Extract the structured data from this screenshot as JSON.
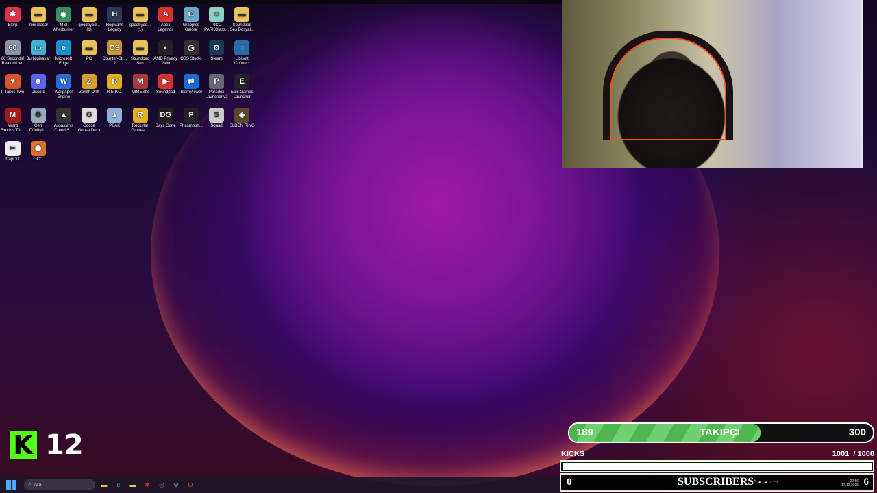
{
  "desktop": {
    "icons": [
      {
        "label": "Blerp",
        "name": "blerp-icon",
        "glyph": "✱",
        "bg": "#d9334a"
      },
      {
        "label": "Yeni klasör",
        "name": "folder-icon",
        "glyph": "▬",
        "bg": "#e8c25a"
      },
      {
        "label": "MSI Afterburner",
        "name": "msi-afterburner-icon",
        "glyph": "◉",
        "bg": "#3a8f5a"
      },
      {
        "label": "goodbyed... (1)",
        "name": "folder-icon",
        "glyph": "▬",
        "bg": "#e8c25a"
      },
      {
        "label": "Hogwarts Legacy",
        "name": "hogwarts-legacy-icon",
        "glyph": "H",
        "bg": "#2a3a55"
      },
      {
        "label": "goodbyed... (1)",
        "name": "folder-icon",
        "glyph": "▬",
        "bg": "#e8c25a"
      },
      {
        "label": "Apex Legends",
        "name": "apex-legends-icon",
        "glyph": "A",
        "bg": "#d8322e"
      },
      {
        "label": "Grapples Galore",
        "name": "grapples-galore-icon",
        "glyph": "G",
        "bg": "#6aa7c4"
      },
      {
        "label": "PICO PARKClass...",
        "name": "pico-park-icon",
        "glyph": "☺",
        "bg": "#8fd0c8"
      },
      {
        "label": "Soundpad Ses Dosyal...",
        "name": "folder-icon",
        "glyph": "▬",
        "bg": "#e8c25a"
      },
      {
        "label": "60 Seconds! Reatomized",
        "name": "60-seconds-icon",
        "glyph": "60",
        "bg": "#8a96a8"
      },
      {
        "label": "Bu bilgisayar",
        "name": "this-pc-icon",
        "glyph": "▭",
        "bg": "#3fb0d8"
      },
      {
        "label": "Microsoft Edge",
        "name": "edge-icon",
        "glyph": "e",
        "bg": "#1c8fd0"
      },
      {
        "label": "PC",
        "name": "folder-icon",
        "glyph": "▬",
        "bg": "#e8c25a"
      },
      {
        "label": "Counter-Str... 2",
        "name": "counter-strike-icon",
        "glyph": "CS",
        "bg": "#c79a3a"
      },
      {
        "label": "Soundpad Ses",
        "name": "folder-icon",
        "glyph": "▬",
        "bg": "#e8c25a"
      },
      {
        "label": "AMD Privacy View",
        "name": "amd-privacy-view-icon",
        "glyph": "◐",
        "bg": "#222"
      },
      {
        "label": "OBS Studio",
        "name": "obs-studio-icon",
        "glyph": "◎",
        "bg": "#333"
      },
      {
        "label": "Steam",
        "name": "steam-icon",
        "glyph": "⚙",
        "bg": "#1b3a5a"
      },
      {
        "label": "Ubisoft Connect",
        "name": "ubisoft-connect-icon",
        "glyph": "◌",
        "bg": "#2a6aa8"
      },
      {
        "label": "It Takes Two",
        "name": "it-takes-two-icon",
        "glyph": "♥",
        "bg": "#d8562e"
      },
      {
        "label": "Discord",
        "name": "discord-icon",
        "glyph": "☻",
        "bg": "#5865f2"
      },
      {
        "label": "Wallpaper Engine",
        "name": "wallpaper-engine-icon",
        "glyph": "W",
        "bg": "#2a6ad8"
      },
      {
        "label": "Zenith Drift",
        "name": "zenith-drift-icon",
        "glyph": "Z",
        "bg": "#d8a02e"
      },
      {
        "label": "R.E.P.O.",
        "name": "repo-icon",
        "glyph": "R",
        "bg": "#e0b020"
      },
      {
        "label": "MIMESIS",
        "name": "mimesis-icon",
        "glyph": "M",
        "bg": "#aa3a3a"
      },
      {
        "label": "Soundpad",
        "name": "soundpad-icon",
        "glyph": "▶",
        "bg": "#d83030"
      },
      {
        "label": "TeamViewer",
        "name": "teamviewer-icon",
        "glyph": "⇄",
        "bg": "#1a6ad8"
      },
      {
        "label": "Paradox Launcher v2",
        "name": "paradox-launcher-icon",
        "glyph": "P",
        "bg": "#667"
      },
      {
        "label": "Epic Games Launcher",
        "name": "epic-games-icon",
        "glyph": "E",
        "bg": "#222"
      },
      {
        "label": "Metro Exodus Tür...",
        "name": "metro-exodus-icon",
        "glyph": "M",
        "bg": "#a81a1a"
      },
      {
        "label": "Geri Dönüşü...",
        "name": "recycle-bin-icon",
        "glyph": "♻",
        "bg": "#9ab"
      },
      {
        "label": "Assassin's Creed S...",
        "name": "assassins-creed-icon",
        "glyph": "▲",
        "bg": "#333"
      },
      {
        "label": "Goose Goose Duck",
        "name": "goose-goose-duck-icon",
        "glyph": "G",
        "bg": "#ddd"
      },
      {
        "label": "PEAK",
        "name": "peak-icon",
        "glyph": "▲",
        "bg": "#8fb0d8"
      },
      {
        "label": "Rockstar Games ...",
        "name": "rockstar-games-icon",
        "glyph": "R",
        "bg": "#e0b020"
      },
      {
        "label": "Days Gone",
        "name": "days-gone-icon",
        "glyph": "DG",
        "bg": "#222"
      },
      {
        "label": "Phasmoph...",
        "name": "phasmophobia-icon",
        "glyph": "P",
        "bg": "#222"
      },
      {
        "label": "Squad",
        "name": "squad-icon",
        "glyph": "S",
        "bg": "#ccc"
      },
      {
        "label": "ELDEN RING",
        "name": "elden-ring-icon",
        "glyph": "◈",
        "bg": "#5a4a2a"
      },
      {
        "label": "CapCut",
        "name": "capcut-icon",
        "glyph": "✂",
        "bg": "#eee"
      },
      {
        "label": "GCC",
        "name": "gcc-icon",
        "glyph": "⬢",
        "bg": "#e0702e"
      }
    ]
  },
  "overlay": {
    "kick_logo": "K",
    "kick_viewers": "12",
    "followers": {
      "current": "189",
      "label": "TAKIPÇI",
      "goal": "300",
      "progress": 0.63
    },
    "kicks": {
      "label": "KICKS",
      "count": "1001",
      "goal": "/ 1000",
      "progress": 1.0
    },
    "subs": {
      "current": "0",
      "label": "SUBSCRIBERS",
      "goal": "6"
    }
  },
  "taskbar": {
    "search_placeholder": "Ara",
    "apps": [
      {
        "name": "file-explorer-icon",
        "glyph": "▬",
        "color": "#e8c25a"
      },
      {
        "name": "edge-taskbar-icon",
        "glyph": "e",
        "color": "#1c8fd0"
      },
      {
        "name": "folder-taskbar-icon",
        "glyph": "▬",
        "color": "#e8c25a"
      },
      {
        "name": "blerp-taskbar-icon",
        "glyph": "✱",
        "color": "#d9334a"
      },
      {
        "name": "obs-taskbar-icon",
        "glyph": "◎",
        "color": "#888"
      },
      {
        "name": "steam-taskbar-icon",
        "glyph": "⚙",
        "color": "#8ab"
      },
      {
        "name": "opera-taskbar-icon",
        "glyph": "O",
        "color": "#e33"
      }
    ],
    "tray_text": "^  ▲ ☁ ♪ ▭",
    "time": "20:56",
    "date": "17.12.2025"
  }
}
